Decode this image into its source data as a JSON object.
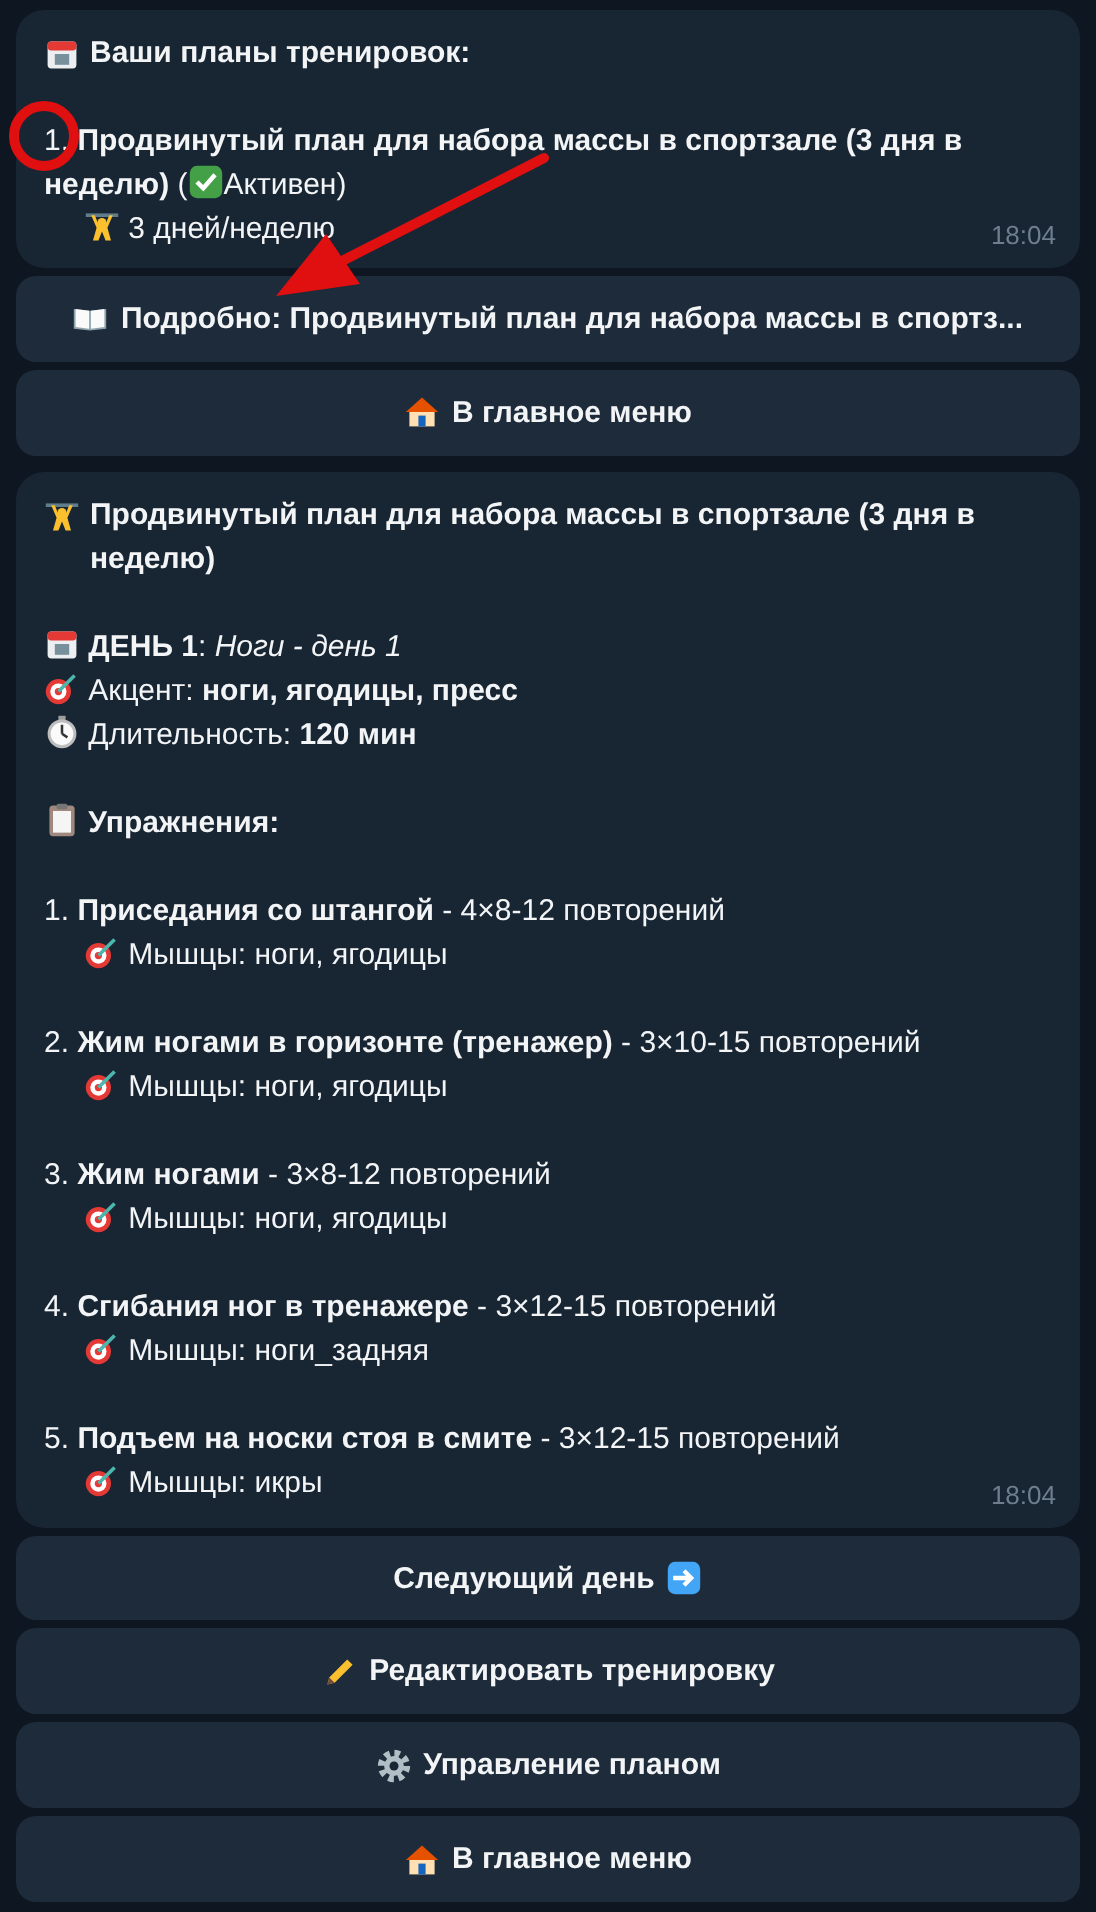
{
  "plans_message": {
    "title": "Ваши планы тренировок:",
    "plans": [
      {
        "text": "1. **Продвинутый план для набора массы в спортзале (3 дня в неделю)** (",
        "active": true,
        "status": "Активен)",
        "schedule": "3 дней/неделю"
      }
    ],
    "time": "18:04"
  },
  "plan_buttons": [
    {
      "kind": "details",
      "label": "Подробно: Продвинутый план для набора массы в спортз..."
    },
    {
      "kind": "home",
      "label": "В главное меню"
    }
  ],
  "plan_message": {
    "title": "Продвинутый план для набора массы в спортзале (3 дня в неделю)",
    "day": "**ДЕНЬ 1**: *Ноги - день 1*",
    "accent": "Акцент: **ноги, ягодицы, пресс**",
    "duration": "Длительность: **120 мин**",
    "exercises_heading": "Упражнения:",
    "exercises": [
      {
        "text": "1. **Приседания со штангой** - 4×8-12 повторений",
        "muscles": "Мышцы: ноги, ягодицы"
      },
      {
        "text": "2. **Жим ногами в горизонте (тренажер)** - 3×10-15 повторений",
        "muscles": "Мышцы: ноги, ягодицы"
      },
      {
        "text": "3. **Жим ногами** - 3×8-12 повторений",
        "muscles": "Мышцы: ноги, ягодицы"
      },
      {
        "text": "4. **Сгибания ног в тренажере** - 3×12-15 повторений",
        "muscles": "Мышцы: ноги_задняя"
      },
      {
        "text": "5. **Подъем на носки стоя в смите** - 3×12-15 повторений",
        "muscles": "Мышцы: икры"
      }
    ],
    "time": "18:04"
  },
  "day_buttons": [
    {
      "kind": "next",
      "label": "Следующий день"
    },
    {
      "kind": "edit",
      "label": "Редактировать тренировку"
    },
    {
      "kind": "manage",
      "label": "Управление планом"
    },
    {
      "kind": "home",
      "label": "В главное меню"
    }
  ],
  "annotations": {
    "highlight_circle": true,
    "arrow": true
  }
}
